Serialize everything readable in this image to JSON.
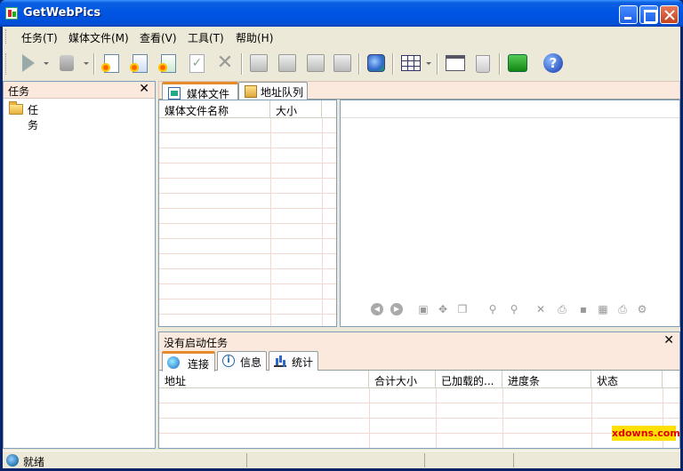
{
  "window": {
    "title": "GetWebPics"
  },
  "menu": [
    "任务(T)",
    "媒体文件(M)",
    "查看(V)",
    "工具(T)",
    "帮助(H)"
  ],
  "tasks_panel": {
    "title": "任务",
    "close": "✕",
    "tree": [
      "任务"
    ]
  },
  "tabs": [
    "媒体文件",
    "地址队列"
  ],
  "media_list": {
    "columns": [
      "媒体文件名称",
      "大小"
    ]
  },
  "bottom_panel": {
    "title": "没有启动任务",
    "close": "✕",
    "tabs": [
      "连接",
      "信息",
      "统计"
    ],
    "columns": [
      "地址",
      "合计大小",
      "已加载的...",
      "进度条",
      "状态"
    ]
  },
  "status": {
    "text": "就绪"
  },
  "watermark": "xdowns.com",
  "icons": {
    "toolbar": [
      "start-icon",
      "stop-icon",
      "new-task-icon",
      "new-task-blue-icon",
      "new-task-green-icon",
      "check-icon",
      "delete-icon",
      "search-icon",
      "tools-icon",
      "media-icon",
      "remove-icon",
      "browser-icon",
      "view-grid-icon",
      "window-icon",
      "trash-icon",
      "export-icon",
      "help-icon"
    ]
  }
}
